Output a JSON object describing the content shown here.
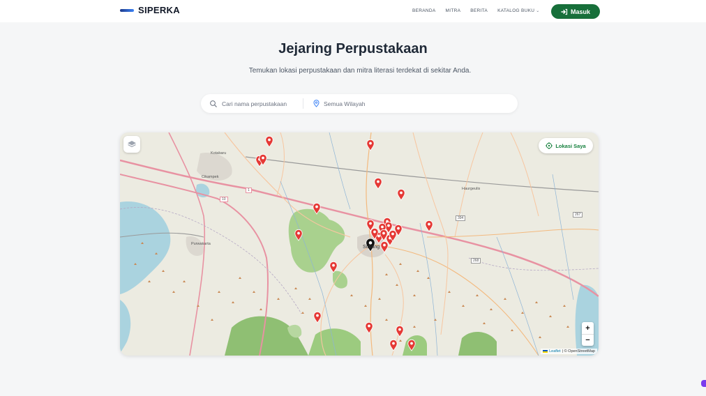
{
  "brand": {
    "name": "SIPERKA"
  },
  "nav": {
    "items": [
      {
        "label": "BERANDA"
      },
      {
        "label": "MITRA"
      },
      {
        "label": "BERITA"
      },
      {
        "label": "KATALOG BUKU"
      }
    ],
    "login_label": "Masuk"
  },
  "hero": {
    "title": "Jejaring Perpustakaan",
    "subtitle": "Temukan lokasi perpustakaan dan mitra literasi terdekat di sekitar Anda."
  },
  "search": {
    "placeholder": "Cari nama perpustakaan",
    "region_label": "Semua Wilayah"
  },
  "map": {
    "locate_label": "Lokasi Saya",
    "zoom_in": "+",
    "zoom_out": "−",
    "attribution_leaflet": "Leaflet",
    "attribution_osm": "| © OpenStreetMap",
    "place_labels": [
      "Kotabaru",
      "Cikampek",
      "Purwakarta",
      "Haurgeulis",
      "Subang"
    ],
    "road_numbers": [
      "1",
      "10",
      "394",
      "267",
      "268"
    ],
    "marker_color": "#e53935",
    "user_marker_color": "#111111",
    "library_marker_count": 26
  },
  "colors": {
    "accent": "#176f3a",
    "title": "#1f2937"
  }
}
